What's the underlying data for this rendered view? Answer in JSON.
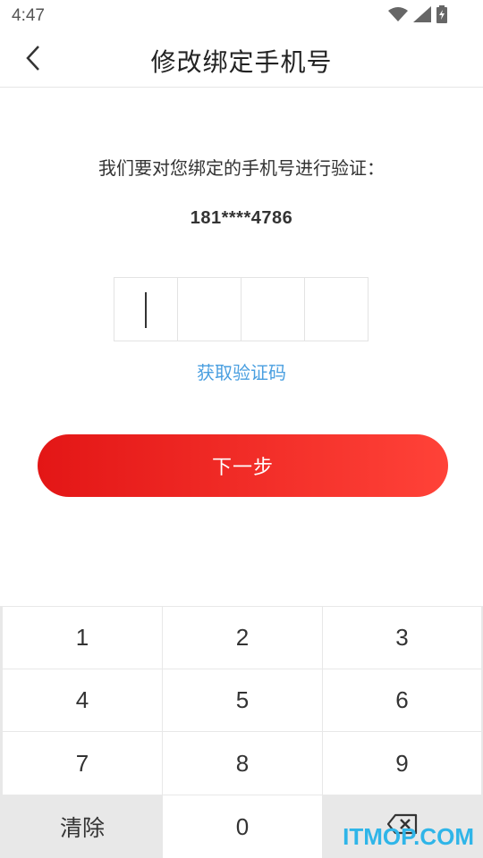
{
  "status_bar": {
    "time": "4:47",
    "icons": [
      "wifi-icon",
      "signal-icon",
      "battery-icon"
    ]
  },
  "header": {
    "title": "修改绑定手机号",
    "back_icon": "chevron-left-icon"
  },
  "verify": {
    "tip": "我们要对您绑定的手机号进行验证：",
    "phone": "181****4786",
    "code_boxes": [
      "",
      "",
      "",
      ""
    ],
    "get_code_label": "获取验证码"
  },
  "next_button": {
    "label": "下一步",
    "gradient_start": "#e31616",
    "gradient_end": "#ff4238"
  },
  "keypad": {
    "keys": [
      "1",
      "2",
      "3",
      "4",
      "5",
      "6",
      "7",
      "8",
      "9"
    ],
    "clear_label": "清除",
    "zero_label": "0",
    "delete_icon": "backspace-icon"
  },
  "watermark": "ITMOP.COM",
  "colors": {
    "accent": "#e31616",
    "link": "#4a9fe0"
  }
}
